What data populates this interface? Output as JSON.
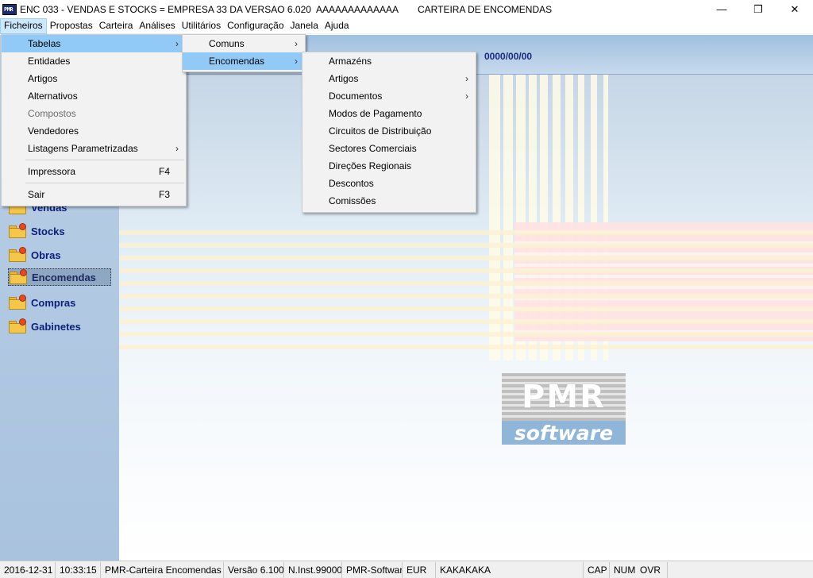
{
  "window": {
    "title": "ENC 033 - VENDAS E STOCKS = EMPRESA 33 DA VERSAO 6.020  AAAAAAAAAAAAA",
    "subtitle": "CARTEIRA DE ENCOMENDAS",
    "icon_text": "PMR",
    "controls": {
      "minimize": "—",
      "restore": "❐",
      "close": "✕"
    }
  },
  "menubar": [
    "Ficheiros",
    "Propostas",
    "Carteira",
    "Análises",
    "Utilitários",
    "Configuração",
    "Janela",
    "Ajuda"
  ],
  "ficheiros_menu": {
    "tabelas": "Tabelas",
    "entidades": "Entidades",
    "artigos": "Artigos",
    "alternativos": "Alternativos",
    "compostos": "Compostos",
    "vendedores": "Vendedores",
    "listagens": "Listagens Parametrizadas",
    "impressora": "Impressora",
    "impressora_shortcut": "F4",
    "sair": "Sair",
    "sair_shortcut": "F3"
  },
  "tabelas_menu": {
    "comuns": "Comuns",
    "encomendas": "Encomendas"
  },
  "encomendas_menu": [
    "Armazéns",
    "Artigos",
    "Documentos",
    "Modos de Pagamento",
    "Circuitos de Distribuição",
    "Sectores Comerciais",
    "Direções Regionais",
    "Descontos",
    "Comissões"
  ],
  "toolbar": {
    "date": "0000/00/00"
  },
  "modules": [
    "Vendas",
    "Stocks",
    "Obras",
    "Encomendas",
    "Compras",
    "Gabinetes"
  ],
  "logo": {
    "pmr": "PMR",
    "software": "software"
  },
  "statusbar": {
    "date": "2016-12-31",
    "time": "10:33:15",
    "module": "PMR-Carteira Encomendas",
    "version": "Versão  6.100",
    "install": "N.Inst.99000",
    "company": "PMR-Software",
    "currency": "EUR",
    "user": "KAKAKAKA",
    "cap": "CAP",
    "num": "NUM",
    "ovr": "OVR"
  }
}
